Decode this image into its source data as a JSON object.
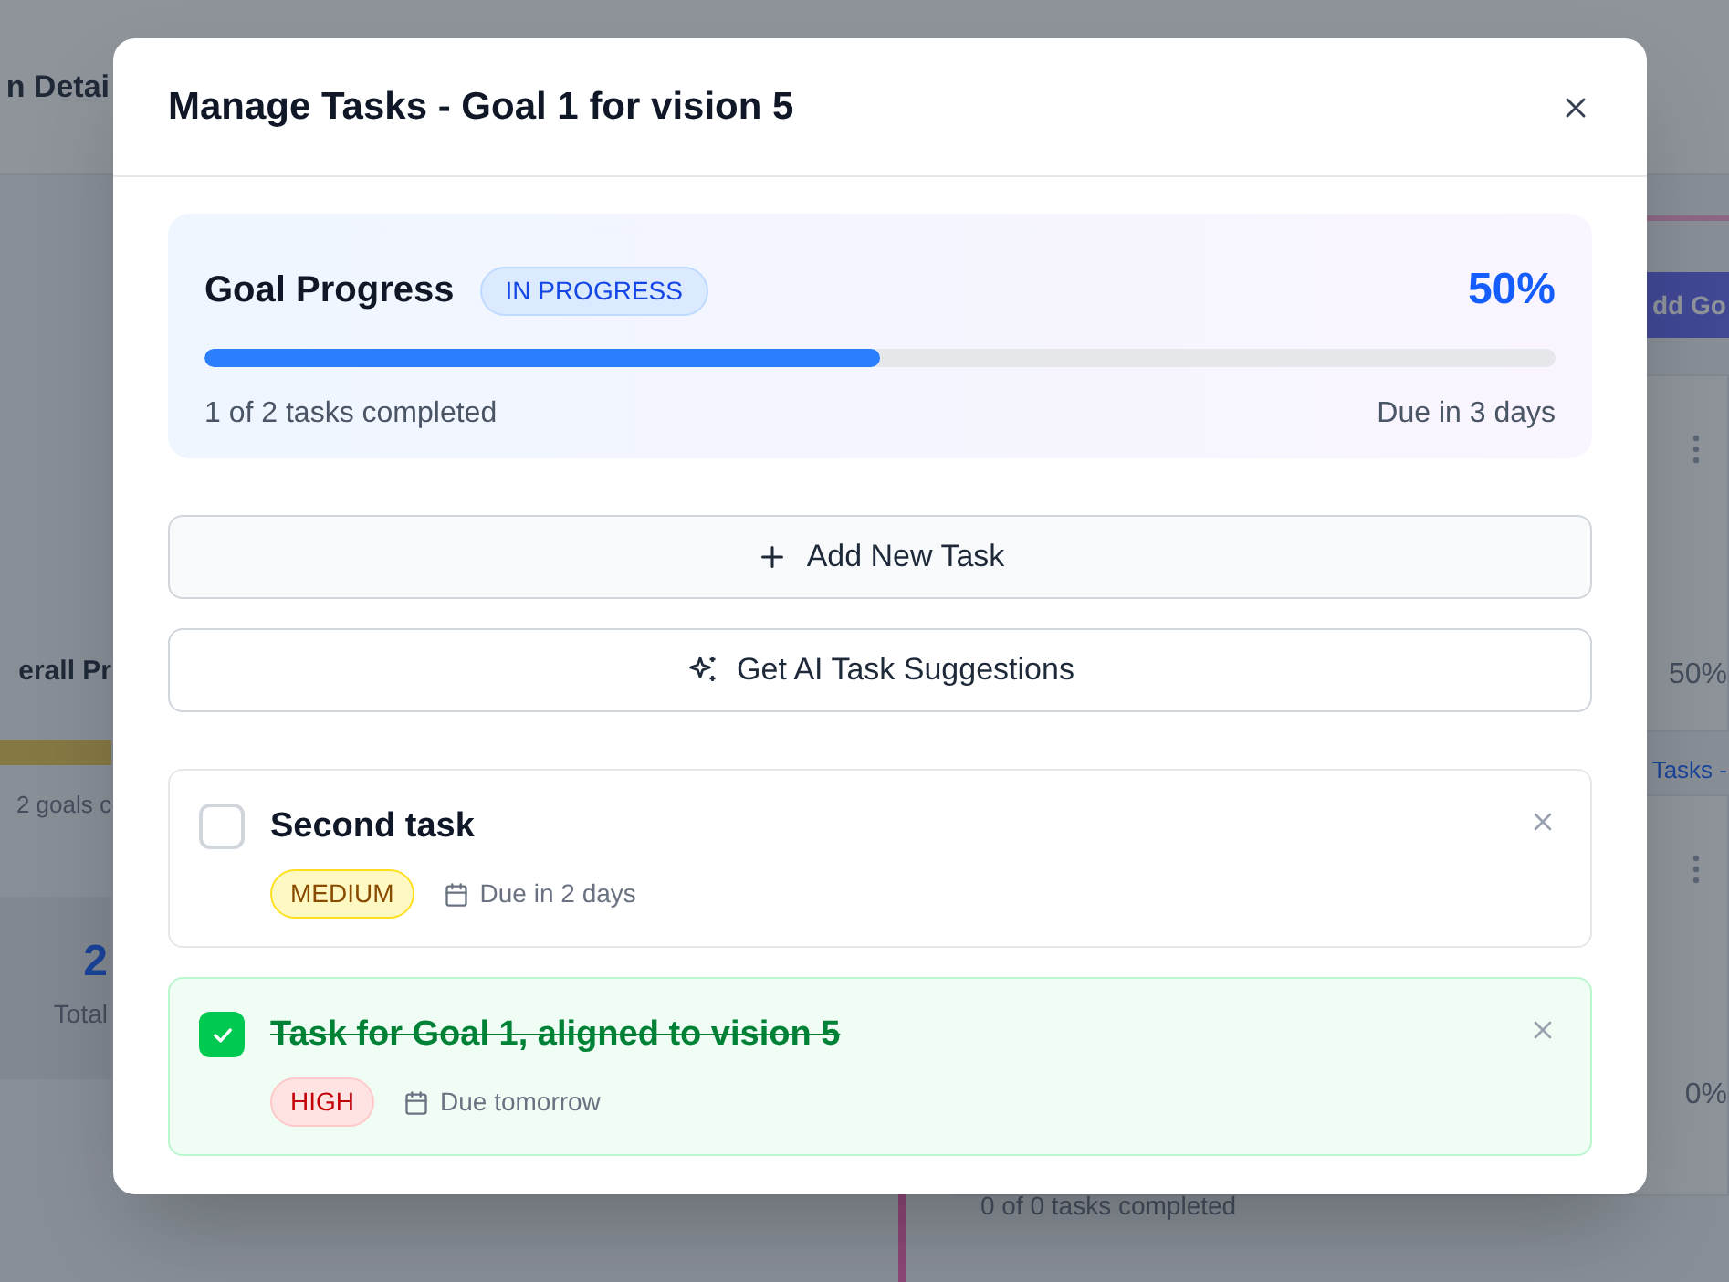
{
  "background_page": {
    "header_title": "n Detai",
    "overall_title": "erall Pr",
    "goals_summary": "2 goals c",
    "stat_value": "2",
    "stat_label": "Total",
    "add_button": "dd Go",
    "goal_cards": [
      {
        "percent": "50%",
        "link": "Tasks -"
      },
      {
        "percent": "0%",
        "summary": "0 of 0 tasks completed"
      }
    ]
  },
  "modal": {
    "title": "Manage Tasks - Goal 1 for vision 5",
    "progress": {
      "title": "Goal Progress",
      "status": "IN PROGRESS",
      "percent": "50%",
      "level": 0.5,
      "summary": "1 of 2 tasks completed",
      "due": "Due in 3 days"
    },
    "actions": [
      {
        "kind": "add",
        "label": "Add New Task"
      },
      {
        "kind": "ai",
        "label": "Get AI Task Suggestions"
      }
    ],
    "tasks": [
      {
        "title": "Second task",
        "completed": false,
        "priority": {
          "kind": "medium",
          "label": "MEDIUM"
        },
        "due": "Due in 2 days"
      },
      {
        "title": "Task for Goal 1, aligned to vision 5",
        "completed": true,
        "priority": {
          "kind": "high",
          "label": "HIGH"
        },
        "due": "Due tomorrow"
      }
    ]
  }
}
